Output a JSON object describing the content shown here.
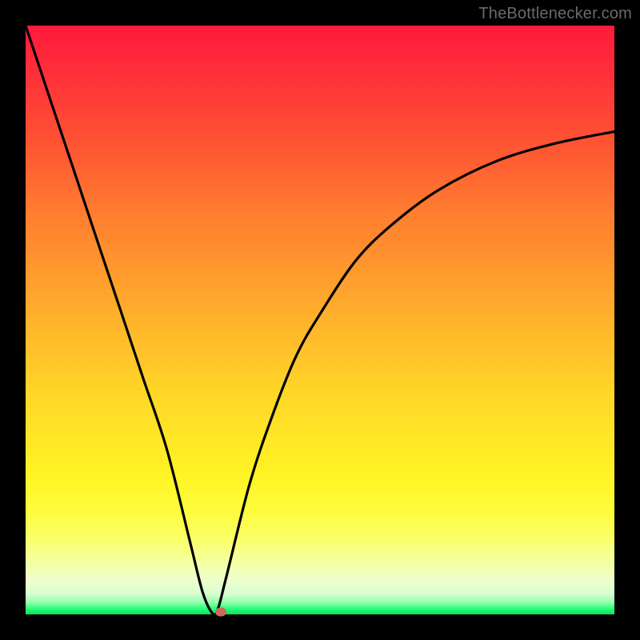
{
  "watermark": "TheBottlenecker.com",
  "colors": {
    "frame": "#000000",
    "gradient_top": "#ff1a3d",
    "gradient_bottom": "#0ae060",
    "curve": "#000000",
    "marker": "#c96a5a"
  },
  "chart_data": {
    "type": "line",
    "title": "",
    "xlabel": "",
    "ylabel": "",
    "xlim": [
      0,
      100
    ],
    "ylim": [
      0,
      100
    ],
    "grid": false,
    "legend": false,
    "annotations": [
      "TheBottlenecker.com"
    ],
    "series": [
      {
        "name": "bottleneck-curve",
        "x": [
          0,
          4,
          8,
          12,
          16,
          20,
          24,
          28,
          30,
          31.5,
          32.5,
          34,
          38,
          42,
          46,
          50,
          56,
          62,
          70,
          80,
          90,
          100
        ],
        "y": [
          100,
          88,
          76,
          64,
          52,
          40,
          28,
          12,
          4,
          0.5,
          0.5,
          6,
          22,
          34,
          44,
          51,
          60,
          66,
          72,
          77,
          80,
          82
        ]
      }
    ],
    "marker": {
      "x": 33.2,
      "y": 0.4
    },
    "gradient_stops": [
      {
        "pos": 0,
        "color": "#ff1a3d"
      },
      {
        "pos": 0.14,
        "color": "#ff4136"
      },
      {
        "pos": 0.3,
        "color": "#ff7730"
      },
      {
        "pos": 0.46,
        "color": "#ffa62c"
      },
      {
        "pos": 0.62,
        "color": "#ffd528"
      },
      {
        "pos": 0.76,
        "color": "#fff324"
      },
      {
        "pos": 0.87,
        "color": "#fbff66"
      },
      {
        "pos": 0.94,
        "color": "#eeffcc"
      },
      {
        "pos": 0.98,
        "color": "#8fffac"
      },
      {
        "pos": 1.0,
        "color": "#0ae060"
      }
    ]
  }
}
